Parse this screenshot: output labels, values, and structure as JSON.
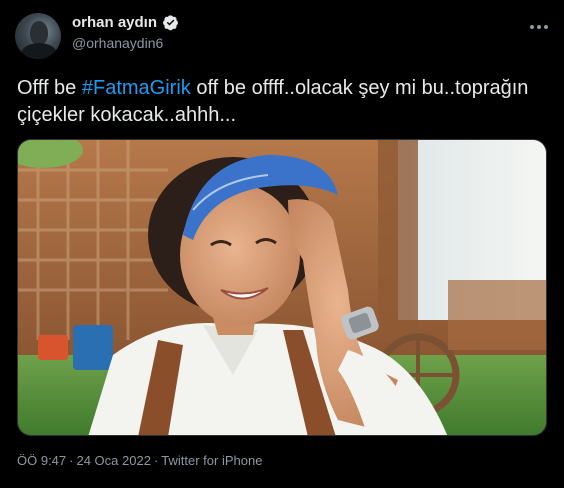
{
  "user": {
    "display_name": "orhan aydın",
    "handle": "@orhanaydin6",
    "verified": true
  },
  "tweet": {
    "text_before": "Offf be ",
    "hashtag": "#FatmaGirik",
    "text_after": " off be offff..olacak şey mi bu..toprağın çiçekler kokacak..ahhh..."
  },
  "meta": {
    "time": "ÖÖ 9:47",
    "separator": "·",
    "date": "24 Oca 2022",
    "source": "Twitter for iPhone"
  },
  "colors": {
    "background": "#000000",
    "text": "#e7e9ea",
    "secondary": "#8b98a5",
    "accent": "#1d9bf0"
  },
  "icons": {
    "verified": "verified-badge-icon",
    "more": "more-options-icon"
  }
}
